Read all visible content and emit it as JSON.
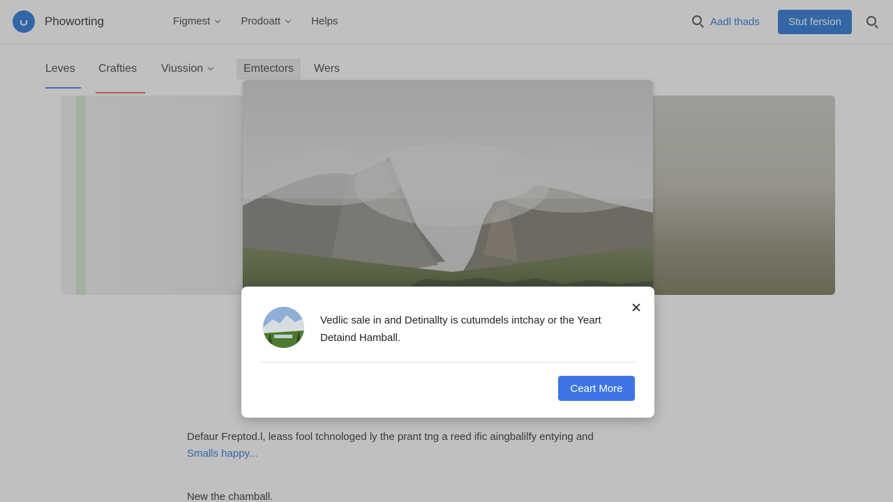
{
  "header": {
    "brand": "Phoworting",
    "nav": [
      {
        "label": "Figmest",
        "has_dropdown": true
      },
      {
        "label": "Prodoatt",
        "has_dropdown": true
      },
      {
        "label": "Helps",
        "has_dropdown": false
      }
    ],
    "search_icon": "search-icon",
    "link_label": "Aadl thads",
    "cta_label": "Stut fersion",
    "accent": "#1a6fd6"
  },
  "tabs": [
    {
      "label": "Leves",
      "active": true
    },
    {
      "label": "Crafties",
      "active": false
    },
    {
      "label": "Viussion",
      "active": false,
      "has_dropdown": true
    },
    {
      "label": "Emtectors",
      "active": false,
      "highlighted": true
    },
    {
      "label": "Wers",
      "active": false
    }
  ],
  "content": {
    "paragraph": "Defaur Freptod.l, leass fool tchnologed ly the prant tng a reed ific aingbalilfy entying and",
    "link_text": "Smalls happy...",
    "footer_line": "New the chamball."
  },
  "dialog": {
    "message": "Vedlic sale in and Detinallty is cutumdels intchay or the Yeart Detaind Hamball.",
    "button_label": "Ceart More",
    "button_color": "#3f74e6",
    "close_icon": "close-icon"
  }
}
